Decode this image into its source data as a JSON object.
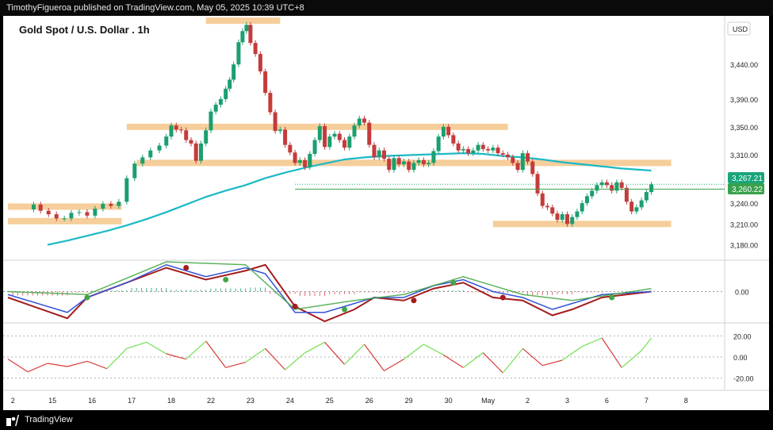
{
  "header": {
    "publisher_line": "TimothyFigueroa published on TradingView.com, May 05, 2025 10:39 UTC+8"
  },
  "footer": {
    "brand": "TradingView"
  },
  "chart": {
    "title": "Gold Spot / U.S. Dollar . 1h",
    "currency": "USD",
    "price_ticks": [
      "3,440.00",
      "3,390.00",
      "3,350.00",
      "3,310.00",
      "3,240.00",
      "3,210.00",
      "3,180.00"
    ],
    "price_tag_last": "3,267.21",
    "price_tag_ma": "3,260.22",
    "macd_tick": "0.00",
    "rsi_ticks": [
      "20.00",
      "0.00",
      "-20.00"
    ],
    "x_labels": [
      "2",
      "15",
      "16",
      "17",
      "18",
      "22",
      "23",
      "24",
      "25",
      "26",
      "29",
      "30",
      "May",
      "2",
      "3",
      "6",
      "7",
      "8"
    ]
  },
  "chart_data": {
    "type": "candlestick",
    "title": "Gold Spot / U.S. Dollar . 1h",
    "ylabel": "USD",
    "ylim": [
      3160,
      3510
    ],
    "x": [
      "2",
      "15",
      "16",
      "17",
      "18",
      "22",
      "23",
      "24",
      "25",
      "26",
      "29",
      "30",
      "May",
      "2",
      "3",
      "6",
      "7",
      "8"
    ],
    "last_price": 3267.21,
    "ma_price": 3260.22,
    "close_path": [
      [
        2.0,
        3231
      ],
      [
        2.6,
        3238
      ],
      [
        3.3,
        3229
      ],
      [
        4.1,
        3224
      ],
      [
        4.9,
        3218
      ],
      [
        5.7,
        3218
      ],
      [
        6.4,
        3226
      ],
      [
        7.2,
        3227
      ],
      [
        8.0,
        3222
      ],
      [
        8.8,
        3232
      ],
      [
        9.6,
        3239
      ],
      [
        10.4,
        3236
      ],
      [
        11.2,
        3242
      ],
      [
        12.0,
        3276
      ],
      [
        12.8,
        3297
      ],
      [
        13.6,
        3306
      ],
      [
        14.4,
        3316
      ],
      [
        15.3,
        3323
      ],
      [
        16.0,
        3336
      ],
      [
        16.5,
        3352
      ],
      [
        17.0,
        3346
      ],
      [
        17.5,
        3345
      ],
      [
        18.0,
        3331
      ],
      [
        18.5,
        3326
      ],
      [
        19.0,
        3301
      ],
      [
        19.5,
        3326
      ],
      [
        20.0,
        3345
      ],
      [
        20.5,
        3372
      ],
      [
        21.0,
        3382
      ],
      [
        21.5,
        3390
      ],
      [
        22.0,
        3405
      ],
      [
        22.4,
        3418
      ],
      [
        22.8,
        3440
      ],
      [
        23.3,
        3472
      ],
      [
        23.7,
        3488
      ],
      [
        24.1,
        3497
      ],
      [
        24.5,
        3471
      ],
      [
        25.0,
        3455
      ],
      [
        25.5,
        3430
      ],
      [
        26.0,
        3399
      ],
      [
        26.5,
        3371
      ],
      [
        27.0,
        3344
      ],
      [
        27.5,
        3346
      ],
      [
        28.0,
        3324
      ],
      [
        28.5,
        3313
      ],
      [
        29.0,
        3298
      ],
      [
        29.5,
        3302
      ],
      [
        30.0,
        3292
      ],
      [
        30.5,
        3311
      ],
      [
        31.0,
        3331
      ],
      [
        31.5,
        3351
      ],
      [
        32.0,
        3321
      ],
      [
        32.5,
        3336
      ],
      [
        33.0,
        3340
      ],
      [
        33.5,
        3331
      ],
      [
        34.0,
        3320
      ],
      [
        34.5,
        3336
      ],
      [
        35.0,
        3352
      ],
      [
        35.5,
        3362
      ],
      [
        36.0,
        3356
      ],
      [
        36.5,
        3324
      ],
      [
        37.0,
        3306
      ],
      [
        37.5,
        3316
      ],
      [
        38.0,
        3304
      ],
      [
        38.5,
        3288
      ],
      [
        39.0,
        3305
      ],
      [
        39.5,
        3296
      ],
      [
        40.0,
        3300
      ],
      [
        40.5,
        3288
      ],
      [
        41.0,
        3298
      ],
      [
        41.5,
        3302
      ],
      [
        42.0,
        3296
      ],
      [
        42.5,
        3298
      ],
      [
        43.0,
        3315
      ],
      [
        43.5,
        3336
      ],
      [
        44.0,
        3350
      ],
      [
        44.5,
        3338
      ],
      [
        45.0,
        3326
      ],
      [
        45.5,
        3316
      ],
      [
        46.0,
        3318
      ],
      [
        46.5,
        3312
      ],
      [
        47.0,
        3316
      ],
      [
        47.5,
        3324
      ],
      [
        48.0,
        3318
      ],
      [
        48.5,
        3316
      ],
      [
        49.0,
        3320
      ],
      [
        49.5,
        3312
      ],
      [
        50.0,
        3310
      ],
      [
        50.5,
        3306
      ],
      [
        51.0,
        3298
      ],
      [
        51.5,
        3288
      ],
      [
        52.0,
        3312
      ],
      [
        52.5,
        3300
      ],
      [
        53.0,
        3282
      ],
      [
        53.5,
        3254
      ],
      [
        54.0,
        3236
      ],
      [
        54.5,
        3234
      ],
      [
        55.0,
        3225
      ],
      [
        55.5,
        3216
      ],
      [
        56.0,
        3224
      ],
      [
        56.5,
        3210
      ],
      [
        57.0,
        3220
      ],
      [
        57.5,
        3228
      ],
      [
        58.0,
        3240
      ],
      [
        58.5,
        3250
      ],
      [
        59.0,
        3258
      ],
      [
        59.5,
        3266
      ],
      [
        60.0,
        3270
      ],
      [
        60.5,
        3266
      ],
      [
        61.0,
        3258
      ],
      [
        61.5,
        3270
      ],
      [
        62.0,
        3262
      ],
      [
        62.5,
        3242
      ],
      [
        63.0,
        3228
      ],
      [
        63.5,
        3234
      ],
      [
        64.0,
        3244
      ],
      [
        64.5,
        3256
      ],
      [
        65.0,
        3267
      ]
    ],
    "ma_series": [
      [
        4.0,
        3180
      ],
      [
        6.0,
        3186
      ],
      [
        8.0,
        3193
      ],
      [
        10.0,
        3200
      ],
      [
        12.0,
        3208
      ],
      [
        14.0,
        3217
      ],
      [
        16.0,
        3227
      ],
      [
        18.0,
        3238
      ],
      [
        20.0,
        3249
      ],
      [
        22.0,
        3258
      ],
      [
        24.0,
        3266
      ],
      [
        26.0,
        3276
      ],
      [
        28.0,
        3284
      ],
      [
        30.0,
        3291
      ],
      [
        32.0,
        3297
      ],
      [
        34.0,
        3303
      ],
      [
        36.0,
        3306
      ],
      [
        38.0,
        3308
      ],
      [
        40.0,
        3309
      ],
      [
        42.0,
        3310
      ],
      [
        44.0,
        3311
      ],
      [
        46.0,
        3312
      ],
      [
        48.0,
        3311
      ],
      [
        50.0,
        3308
      ],
      [
        52.0,
        3306
      ],
      [
        54.0,
        3303
      ],
      [
        56.0,
        3299
      ],
      [
        58.0,
        3296
      ],
      [
        60.0,
        3293
      ],
      [
        62.0,
        3290
      ],
      [
        64.0,
        3288
      ],
      [
        65.0,
        3287
      ]
    ],
    "support_resistance_zones": [
      {
        "x0": 0.0,
        "x1": 11.5,
        "y": 3235
      },
      {
        "x0": 0.0,
        "x1": 11.5,
        "y": 3214
      },
      {
        "x0": 12.0,
        "x1": 50.5,
        "y": 3350
      },
      {
        "x0": 13.0,
        "x1": 67.0,
        "y": 3298
      },
      {
        "x0": 20.0,
        "x1": 27.5,
        "y": 3503
      },
      {
        "x0": 49.0,
        "x1": 67.0,
        "y": 3210
      }
    ],
    "macd_range": [
      -1,
      1
    ],
    "macd_line": [
      [
        0,
        -0.2
      ],
      [
        6,
        -0.9
      ],
      [
        8,
        -0.2
      ],
      [
        12,
        0.3
      ],
      [
        16,
        0.8
      ],
      [
        20,
        0.4
      ],
      [
        24,
        0.7
      ],
      [
        26,
        0.9
      ],
      [
        29,
        -0.5
      ],
      [
        32,
        -1.0
      ],
      [
        35,
        -0.6
      ],
      [
        37,
        -0.2
      ],
      [
        40,
        -0.3
      ],
      [
        43,
        0.1
      ],
      [
        46,
        0.3
      ],
      [
        49,
        -0.2
      ],
      [
        52,
        -0.3
      ],
      [
        55,
        -0.8
      ],
      [
        57,
        -0.6
      ],
      [
        60,
        -0.2
      ],
      [
        65,
        0.0
      ]
    ],
    "macd_signal": [
      [
        0,
        -0.1
      ],
      [
        6,
        -0.7
      ],
      [
        8,
        -0.2
      ],
      [
        12,
        0.3
      ],
      [
        16,
        0.9
      ],
      [
        20,
        0.5
      ],
      [
        24,
        0.8
      ],
      [
        26,
        0.6
      ],
      [
        29,
        -0.7
      ],
      [
        32,
        -0.7
      ],
      [
        35,
        -0.4
      ],
      [
        37,
        -0.2
      ],
      [
        40,
        -0.2
      ],
      [
        43,
        0.2
      ],
      [
        46,
        0.4
      ],
      [
        49,
        0.0
      ],
      [
        52,
        -0.2
      ],
      [
        55,
        -0.6
      ],
      [
        57,
        -0.4
      ],
      [
        60,
        -0.1
      ],
      [
        65,
        0.0
      ]
    ],
    "rsi_range": [
      -30,
      30
    ],
    "rsi_series": [
      [
        0,
        -2
      ],
      [
        2,
        -14
      ],
      [
        4,
        -6
      ],
      [
        6,
        -9
      ],
      [
        8,
        -4
      ],
      [
        10,
        -11
      ],
      [
        12,
        8
      ],
      [
        14,
        14
      ],
      [
        16,
        3
      ],
      [
        18,
        -2
      ],
      [
        20,
        15
      ],
      [
        22,
        -10
      ],
      [
        24,
        -5
      ],
      [
        26,
        8
      ],
      [
        28,
        -12
      ],
      [
        30,
        4
      ],
      [
        32,
        14
      ],
      [
        34,
        -7
      ],
      [
        36,
        12
      ],
      [
        38,
        -13
      ],
      [
        40,
        -2
      ],
      [
        42,
        12
      ],
      [
        44,
        2
      ],
      [
        46,
        -10
      ],
      [
        48,
        4
      ],
      [
        50,
        -15
      ],
      [
        52,
        8
      ],
      [
        54,
        -8
      ],
      [
        56,
        -3
      ],
      [
        58,
        10
      ],
      [
        60,
        18
      ],
      [
        62,
        -10
      ],
      [
        64,
        6
      ],
      [
        65,
        18
      ]
    ]
  },
  "colors": {
    "ma": "#1bb9c5",
    "zone": "#f5c68a",
    "up_candle": "#1b9f6e",
    "down_candle": "#c43b3b",
    "macd_red": "#a51c1c",
    "macd_green": "#42a642",
    "macd_blue": "#3453d8",
    "rsi_green": "#72e052",
    "rsi_red": "#d93b3b"
  }
}
